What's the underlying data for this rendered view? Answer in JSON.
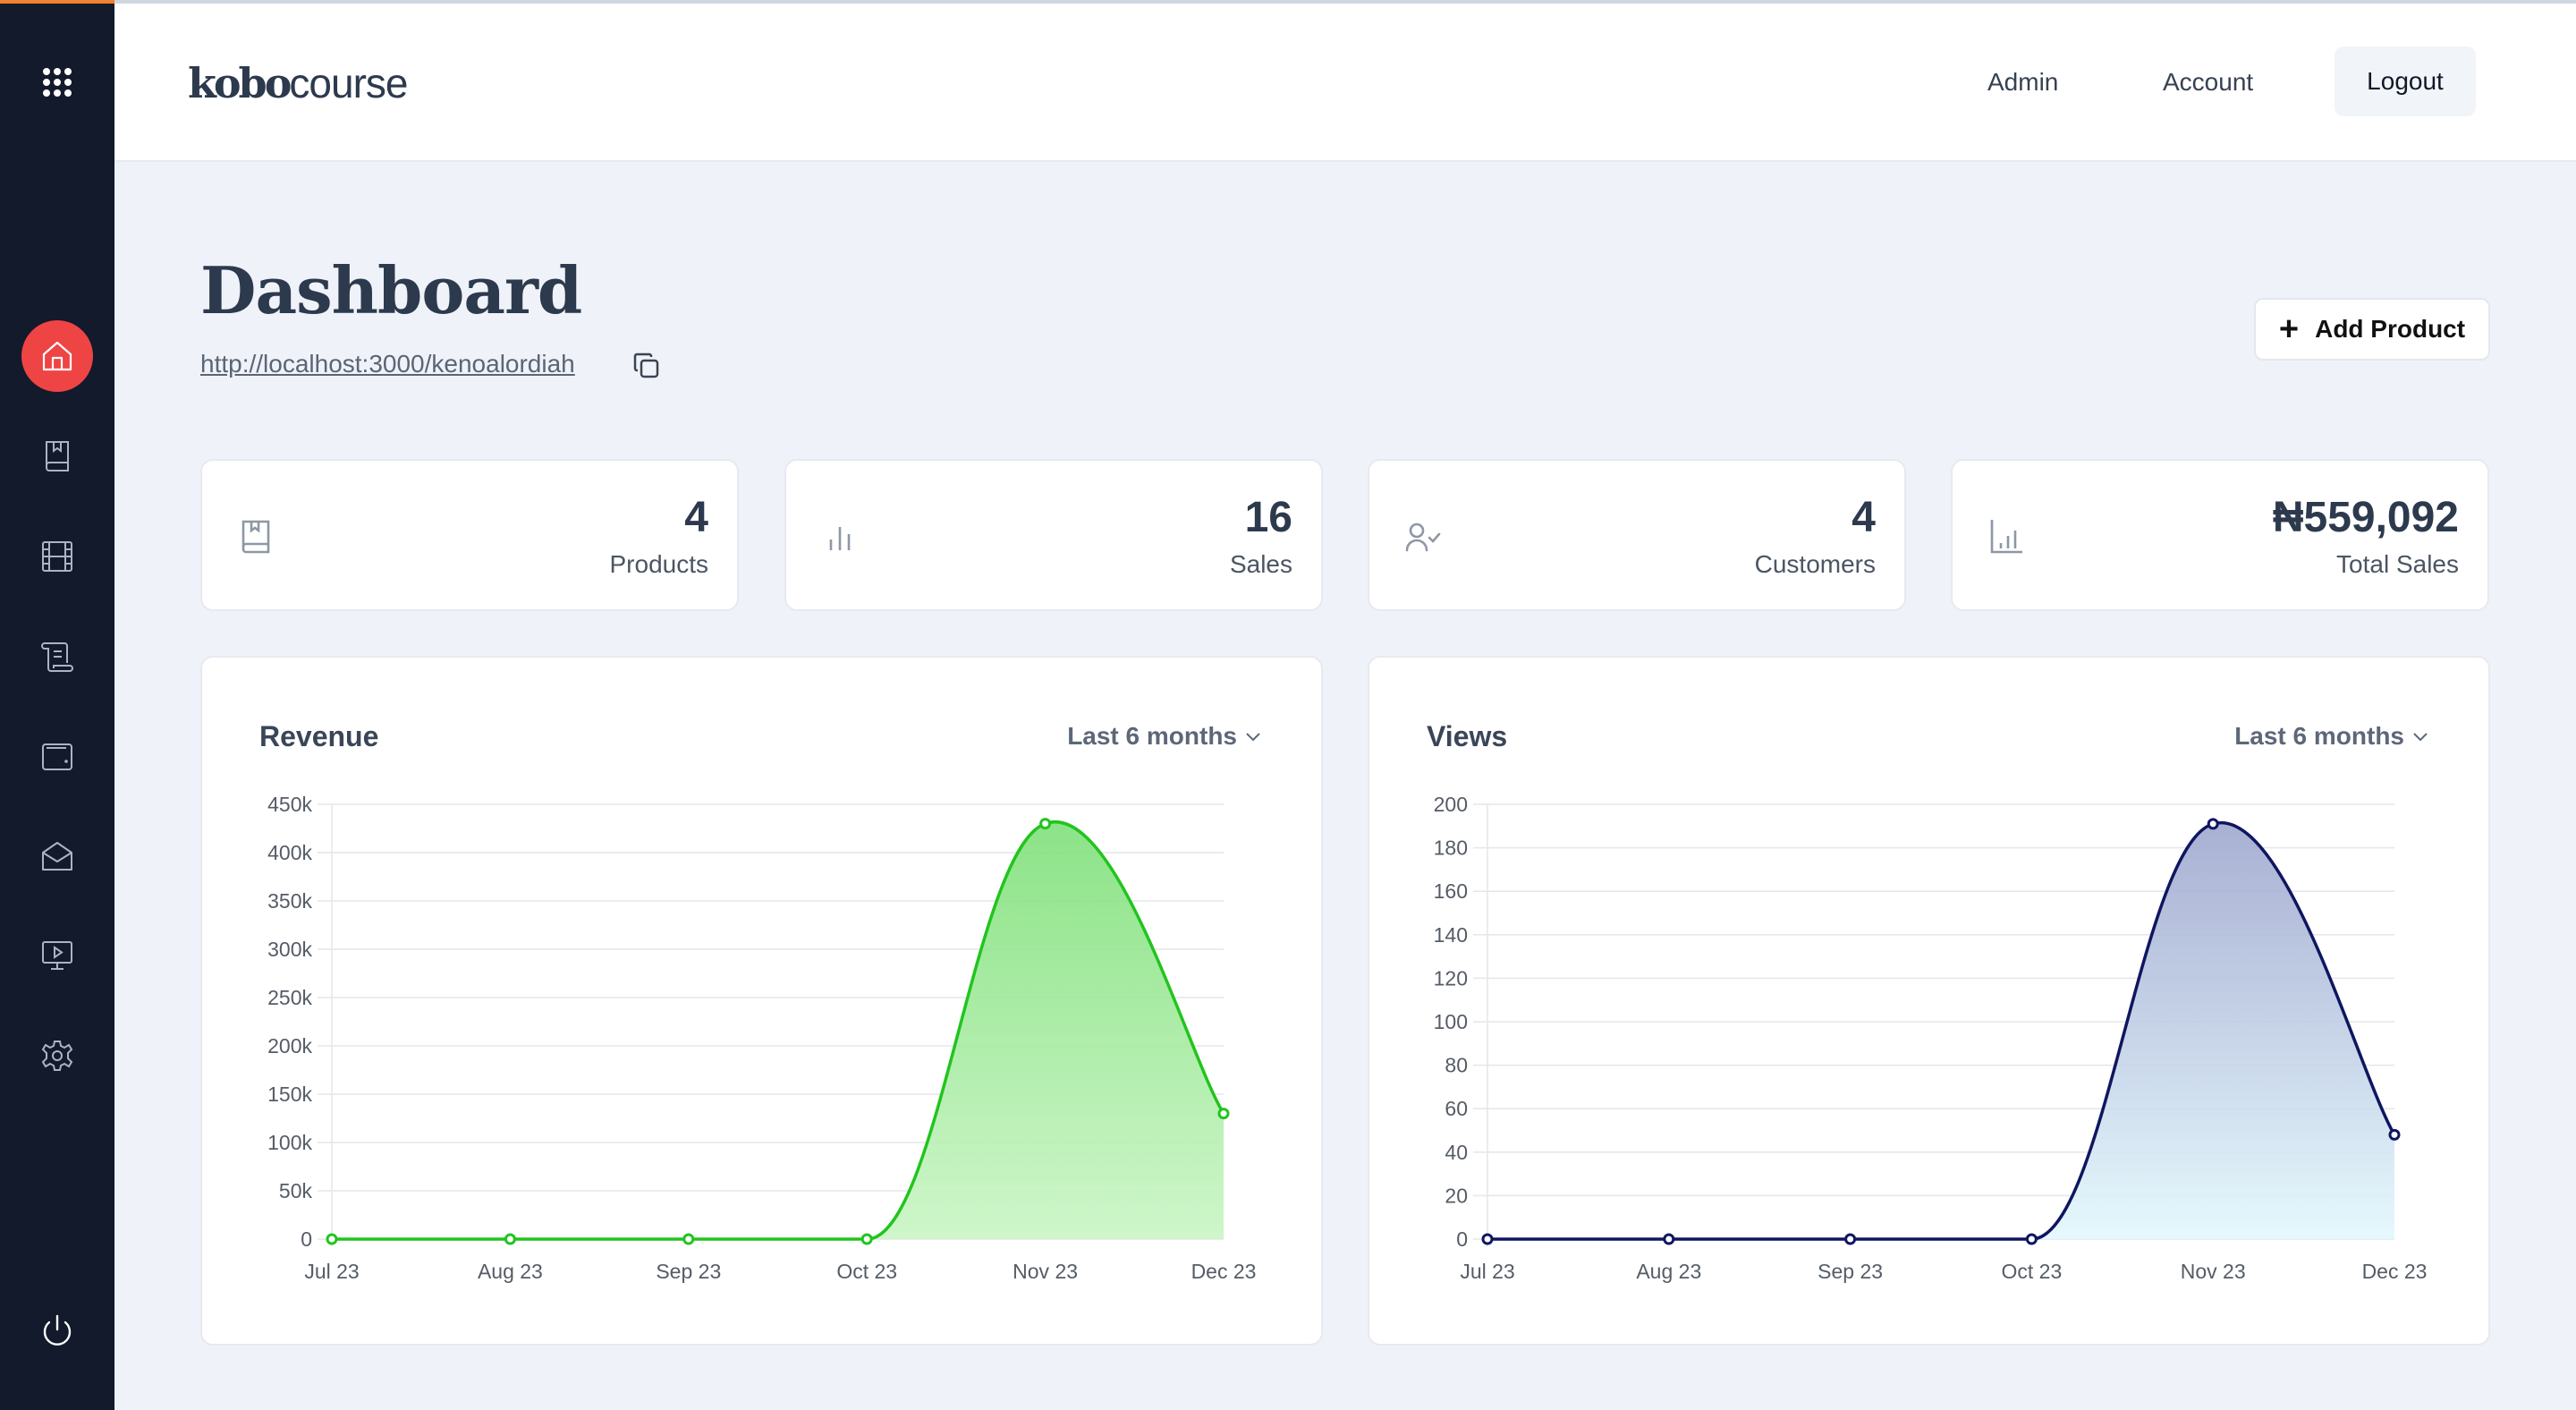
{
  "app": {
    "logo_bold": "kobo",
    "logo_light": "course"
  },
  "sidebar": {
    "items": [
      {
        "name": "apps-grid",
        "icon": "grid-icon"
      },
      {
        "name": "home",
        "icon": "home-icon",
        "active": true
      },
      {
        "name": "products",
        "icon": "book-icon"
      },
      {
        "name": "videos",
        "icon": "film-icon"
      },
      {
        "name": "scripts",
        "icon": "scroll-icon"
      },
      {
        "name": "wallet",
        "icon": "wallet-icon"
      },
      {
        "name": "mail",
        "icon": "mail-open-icon"
      },
      {
        "name": "presentation",
        "icon": "monitor-play-icon"
      },
      {
        "name": "settings",
        "icon": "gear-icon"
      },
      {
        "name": "logout",
        "icon": "power-icon"
      }
    ]
  },
  "header": {
    "nav": {
      "admin": "Admin",
      "account": "Account",
      "logout": "Logout"
    }
  },
  "page": {
    "title": "Dashboard",
    "store_url": "http://localhost:3000/kenoalordiah",
    "add_product_label": "Add Product"
  },
  "stats": [
    {
      "value": "4",
      "label": "Products",
      "icon": "book-icon"
    },
    {
      "value": "16",
      "label": "Sales",
      "icon": "bar-chart-icon"
    },
    {
      "value": "4",
      "label": "Customers",
      "icon": "user-check-icon"
    },
    {
      "value": "₦559,092",
      "label": "Total Sales",
      "icon": "chart-axis-icon"
    }
  ],
  "colors": {
    "sidebar_bg": "#121a2c",
    "active_accent": "#ef4444",
    "revenue_line": "#22c41e",
    "views_line": "#0f1660"
  },
  "chart_data": [
    {
      "type": "area",
      "title": "Revenue",
      "range_label": "Last 6 months",
      "categories": [
        "Jul 23",
        "Aug 23",
        "Sep 23",
        "Oct 23",
        "Nov 23",
        "Dec 23"
      ],
      "series": [
        {
          "name": "Revenue",
          "values": [
            0,
            0,
            0,
            0,
            430000,
            130000
          ]
        }
      ],
      "yticks": [
        0,
        50000,
        100000,
        150000,
        200000,
        250000,
        300000,
        350000,
        400000,
        450000
      ],
      "ytick_labels": [
        "0",
        "50k",
        "100k",
        "150k",
        "200k",
        "250k",
        "300k",
        "350k",
        "400k",
        "450k"
      ],
      "ylim": [
        0,
        450000
      ],
      "grid": true,
      "legend": "none"
    },
    {
      "type": "area",
      "title": "Views",
      "range_label": "Last 6 months",
      "categories": [
        "Jul 23",
        "Aug 23",
        "Sep 23",
        "Oct 23",
        "Nov 23",
        "Dec 23"
      ],
      "series": [
        {
          "name": "Views",
          "values": [
            0,
            0,
            0,
            0,
            191,
            48
          ]
        }
      ],
      "yticks": [
        0,
        20,
        40,
        60,
        80,
        100,
        120,
        140,
        160,
        180,
        200
      ],
      "ytick_labels": [
        "0",
        "20",
        "40",
        "60",
        "80",
        "100",
        "120",
        "140",
        "160",
        "180",
        "200"
      ],
      "ylim": [
        0,
        200
      ],
      "grid": true,
      "legend": "none"
    }
  ]
}
